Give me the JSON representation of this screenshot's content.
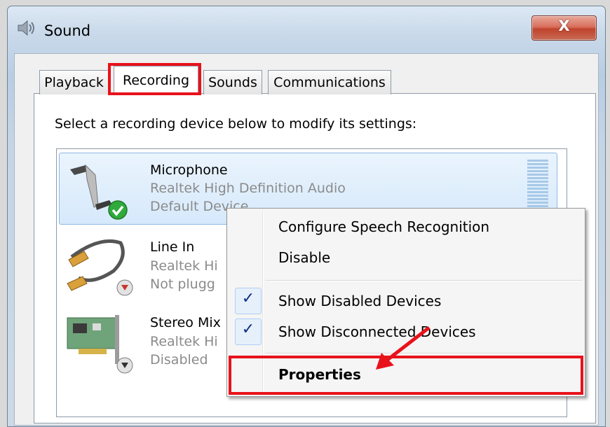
{
  "window": {
    "title": "Sound",
    "close_label": "X"
  },
  "tabs": [
    {
      "label": "Playback",
      "active": false
    },
    {
      "label": "Recording",
      "active": true
    },
    {
      "label": "Sounds",
      "active": false
    },
    {
      "label": "Communications",
      "active": false
    }
  ],
  "instruction": "Select a recording device below to modify its settings:",
  "devices": [
    {
      "name": "Microphone",
      "driver": "Realtek High Definition Audio",
      "status": "Default Device",
      "icon": "microphone-icon",
      "badge": "green-check-icon",
      "selected": true
    },
    {
      "name": "Line In",
      "driver": "Realtek Hi",
      "status": "Not plugg",
      "icon": "rca-cable-icon",
      "badge": "down-arrow-icon",
      "selected": false
    },
    {
      "name": "Stereo Mix",
      "driver": "Realtek Hi",
      "status": "Disabled",
      "icon": "sound-card-icon",
      "badge": "down-arrow-icon",
      "selected": false
    }
  ],
  "context_menu": {
    "items": [
      {
        "label": "Configure Speech Recognition",
        "checked": false
      },
      {
        "label": "Disable",
        "checked": false
      },
      {
        "label": "Show Disabled Devices",
        "checked": true
      },
      {
        "label": "Show Disconnected Devices",
        "checked": true
      },
      {
        "label": "Properties",
        "checked": false,
        "bold": true
      }
    ]
  },
  "annotations": {
    "highlight_color": "#e8121b"
  }
}
